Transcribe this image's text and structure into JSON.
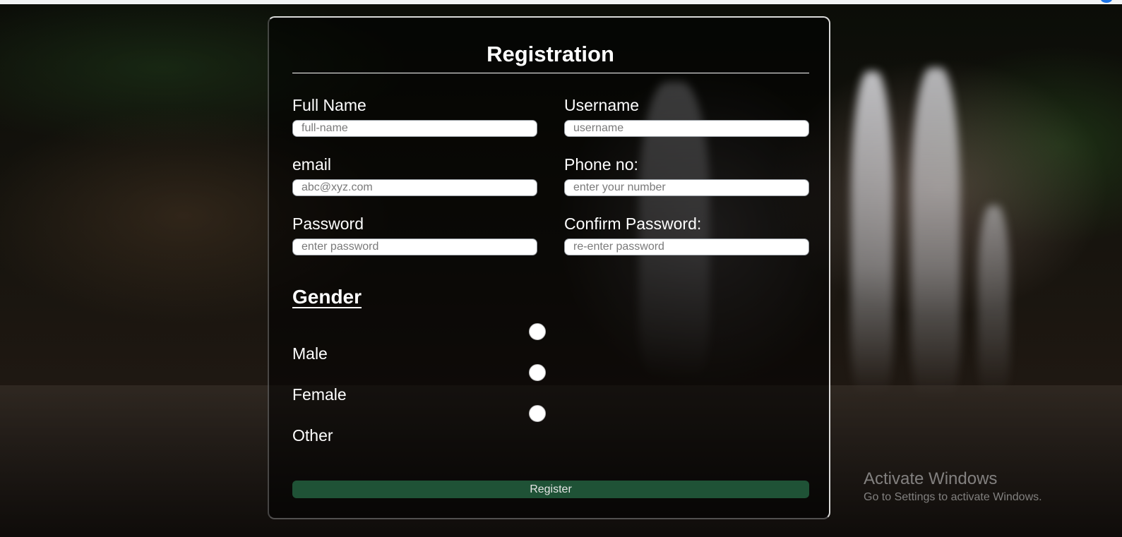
{
  "form": {
    "title": "Registration",
    "fields": [
      {
        "label": "Full Name",
        "placeholder": "full-name",
        "value": ""
      },
      {
        "label": "Username",
        "placeholder": "username",
        "value": ""
      },
      {
        "label": "email",
        "placeholder": "abc@xyz.com",
        "value": ""
      },
      {
        "label": "Phone no:",
        "placeholder": "enter your number",
        "value": ""
      },
      {
        "label": "Password",
        "placeholder": "enter password",
        "value": ""
      },
      {
        "label": "Confirm Password:",
        "placeholder": "re-enter password",
        "value": ""
      }
    ],
    "gender": {
      "title": "Gender",
      "options": [
        "Male",
        "Female",
        "Other"
      ],
      "selected": null
    },
    "submit_label": "Register",
    "submit_color": "#1f5236"
  },
  "watermark": {
    "title": "Activate Windows",
    "subtitle": "Go to Settings to activate Windows."
  },
  "icons": {
    "radio": "radio-button-icon"
  }
}
